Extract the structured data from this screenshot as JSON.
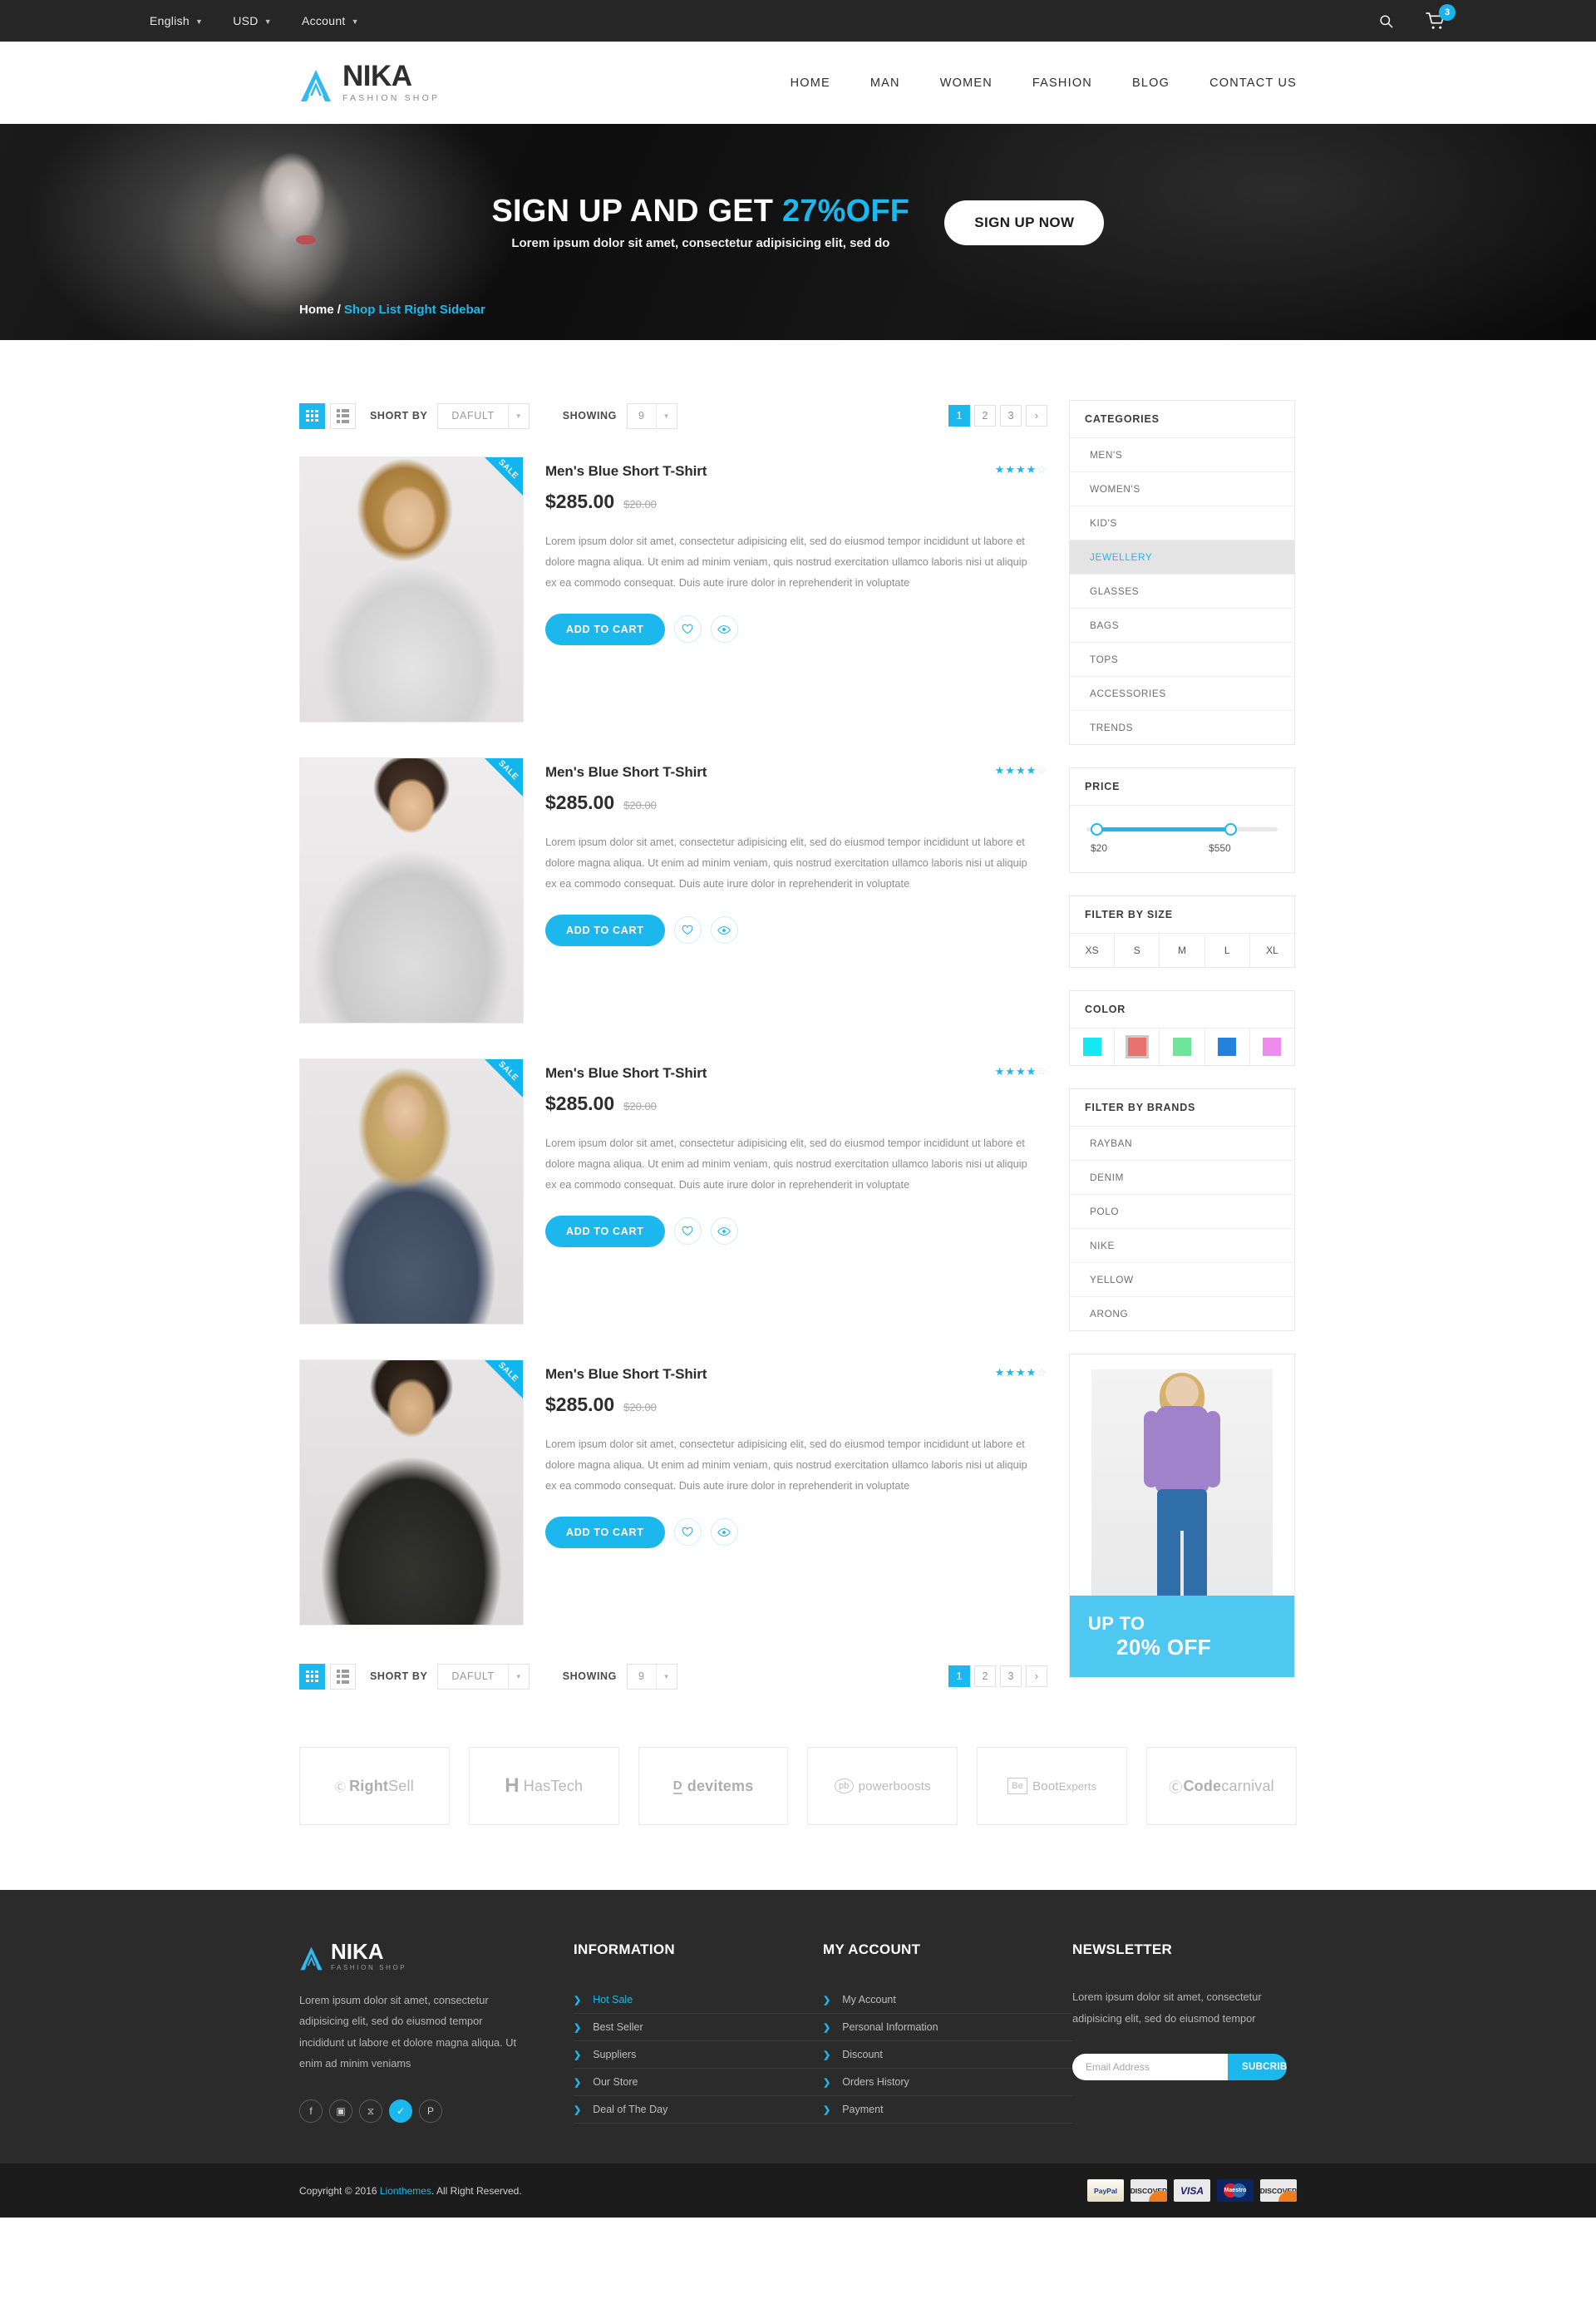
{
  "topbar": {
    "language": "English",
    "currency": "USD",
    "account": "Account",
    "search_icon": "search-icon",
    "cart_icon": "cart-icon",
    "cart_count": "3"
  },
  "brand": {
    "name": "NIKA",
    "tagline": "FASHION SHOP"
  },
  "nav": [
    {
      "label": "HOME"
    },
    {
      "label": "MAN"
    },
    {
      "label": "WOMEN"
    },
    {
      "label": "FASHION"
    },
    {
      "label": "BLOG"
    },
    {
      "label": "CONTACT US"
    }
  ],
  "hero": {
    "title_main": "SIGN UP AND GET ",
    "title_accent": "27%OFF",
    "subtitle": "Lorem ipsum dolor sit amet, consectetur adipisicing elit, sed do",
    "button": "SIGN UP NOW"
  },
  "breadcrumb": {
    "home": "Home",
    "separator": "/",
    "current": "Shop List Right Sidebar"
  },
  "toolbar": {
    "grid_icon": "grid-view-icon",
    "list_icon": "list-view-icon",
    "sort_label": "SHORT BY",
    "sort_value": "DAFULT",
    "showing_label": "SHOWING",
    "showing_value": "9",
    "pages": [
      "1",
      "2",
      "3"
    ],
    "next_label": "›",
    "active_page": "1"
  },
  "products": [
    {
      "title": "Men's Blue Short T-Shirt",
      "price": "$285.00",
      "old_price": "$20.00",
      "rating": 3.5,
      "badge": "SALE",
      "description": "Lorem ipsum dolor sit amet, consectetur adipisicing elit, sed do eiusmod tempor incididunt ut labore et dolore magna aliqua. Ut enim ad minim veniam, quis nostrud exercitation ullamco laboris nisi ut aliquip ex ea commodo consequat. Duis aute irure dolor in reprehenderit in voluptate",
      "cart_label": "ADD TO CART",
      "wishlist_icon": "heart-icon",
      "quickview_icon": "eye-icon"
    },
    {
      "title": "Men's Blue Short T-Shirt",
      "price": "$285.00",
      "old_price": "$20.00",
      "rating": 3.5,
      "badge": "SALE",
      "description": "Lorem ipsum dolor sit amet, consectetur adipisicing elit, sed do eiusmod tempor incididunt ut labore et dolore magna aliqua. Ut enim ad minim veniam, quis nostrud exercitation ullamco laboris nisi ut aliquip ex ea commodo consequat. Duis aute irure dolor in reprehenderit in voluptate",
      "cart_label": "ADD TO CART",
      "wishlist_icon": "heart-icon",
      "quickview_icon": "eye-icon"
    },
    {
      "title": "Men's Blue Short T-Shirt",
      "price": "$285.00",
      "old_price": "$20.00",
      "rating": 3.5,
      "badge": "SALE",
      "description": "Lorem ipsum dolor sit amet, consectetur adipisicing elit, sed do eiusmod tempor incididunt ut labore et dolore magna aliqua. Ut enim ad minim veniam, quis nostrud exercitation ullamco laboris nisi ut aliquip ex ea commodo consequat. Duis aute irure dolor in reprehenderit in voluptate",
      "cart_label": "ADD TO CART",
      "wishlist_icon": "heart-icon",
      "quickview_icon": "eye-icon"
    },
    {
      "title": "Men's Blue Short T-Shirt",
      "price": "$285.00",
      "old_price": "$20.00",
      "rating": 3.5,
      "badge": "SALE",
      "description": "Lorem ipsum dolor sit amet, consectetur adipisicing elit, sed do eiusmod tempor incididunt ut labore et dolore magna aliqua. Ut enim ad minim veniam, quis nostrud exercitation ullamco laboris nisi ut aliquip ex ea commodo consequat. Duis aute irure dolor in reprehenderit in voluptate",
      "cart_label": "ADD TO CART",
      "wishlist_icon": "heart-icon",
      "quickview_icon": "eye-icon"
    }
  ],
  "sidebar": {
    "categories": {
      "title": "CATEGORIES",
      "items": [
        {
          "label": "MEN'S",
          "active": false
        },
        {
          "label": "WOMEN'S",
          "active": false
        },
        {
          "label": "KID'S",
          "active": false
        },
        {
          "label": "JEWELLERY",
          "active": true
        },
        {
          "label": "GLASSES",
          "active": false
        },
        {
          "label": "BAGS",
          "active": false
        },
        {
          "label": "TOPS",
          "active": false
        },
        {
          "label": "ACCESSORIES",
          "active": false
        },
        {
          "label": "TRENDS",
          "active": false
        }
      ]
    },
    "price": {
      "title": "PRICE",
      "min": "$20",
      "max": "$550"
    },
    "size": {
      "title": "FILTER BY SIZE",
      "items": [
        "XS",
        "S",
        "M",
        "L",
        "XL"
      ]
    },
    "color": {
      "title": "COLOR",
      "swatches": [
        "#14e9f2",
        "#e9716f",
        "#6fe49b",
        "#2282dd",
        "#ef8bec"
      ],
      "selected_index": 1
    },
    "brands": {
      "title": "FILTER BY BRANDS",
      "items": [
        "RAYBAN",
        "DENIM",
        "POLO",
        "NIKE",
        "YELLOW",
        "ARONG"
      ]
    },
    "promo": {
      "line1": "UP TO",
      "line2": "20% OFF"
    }
  },
  "partners": [
    {
      "mark": "RS",
      "bold": "Right",
      "rest": "Sell"
    },
    {
      "mark": "H",
      "bold": "Has",
      "rest": "Tech"
    },
    {
      "mark": "D",
      "bold": "dev",
      "rest": "items"
    },
    {
      "mark": "pb",
      "bold": "power",
      "rest": "boosts"
    },
    {
      "mark": "Be",
      "bold": "Boot",
      "rest": "Experts"
    },
    {
      "mark": "C",
      "bold": "Code",
      "rest": "carnival"
    }
  ],
  "footer": {
    "about": "Lorem ipsum dolor sit amet, consectetur adipisicing elit, sed do eiusmod tempor incididunt ut labore et dolore magna aliqua. Ut enim ad minim veniams",
    "socials": [
      {
        "name": "facebook-icon",
        "glyph": "f",
        "active": false
      },
      {
        "name": "instagram-icon",
        "glyph": "▣",
        "active": false
      },
      {
        "name": "rss-icon",
        "glyph": "⧖",
        "active": false
      },
      {
        "name": "twitter-icon",
        "glyph": "✓",
        "active": true
      },
      {
        "name": "pinterest-icon",
        "glyph": "P",
        "active": false
      }
    ],
    "information": {
      "title": "INFORMATION",
      "items": [
        {
          "label": "Hot Sale",
          "highlight": true
        },
        {
          "label": "Best Seller",
          "highlight": false
        },
        {
          "label": "Suppliers",
          "highlight": false
        },
        {
          "label": "Our Store",
          "highlight": false
        },
        {
          "label": "Deal of The Day",
          "highlight": false
        }
      ]
    },
    "account": {
      "title": "MY ACCOUNT",
      "items": [
        {
          "label": "My Account"
        },
        {
          "label": "Personal Information"
        },
        {
          "label": "Discount"
        },
        {
          "label": "Orders History"
        },
        {
          "label": "Payment"
        }
      ]
    },
    "newsletter": {
      "title": "NEWSLETTER",
      "text": "Lorem ipsum dolor sit amet, consectetur adipisicing elit, sed do eiusmod tempor",
      "placeholder": "Email Address",
      "button": "SUBCRIBES"
    }
  },
  "copyright": {
    "prefix": "Copyright © 2016 ",
    "link": "Lionthemes",
    "suffix": ". All Right Reserved.",
    "payments": [
      "PayPal",
      "DISCOVER",
      "VISA",
      "Maestro",
      "DISCOVER"
    ]
  },
  "colors": {
    "accent": "#1cb8ed",
    "dark": "#262626",
    "footer_bg": "#2b2b2b"
  }
}
